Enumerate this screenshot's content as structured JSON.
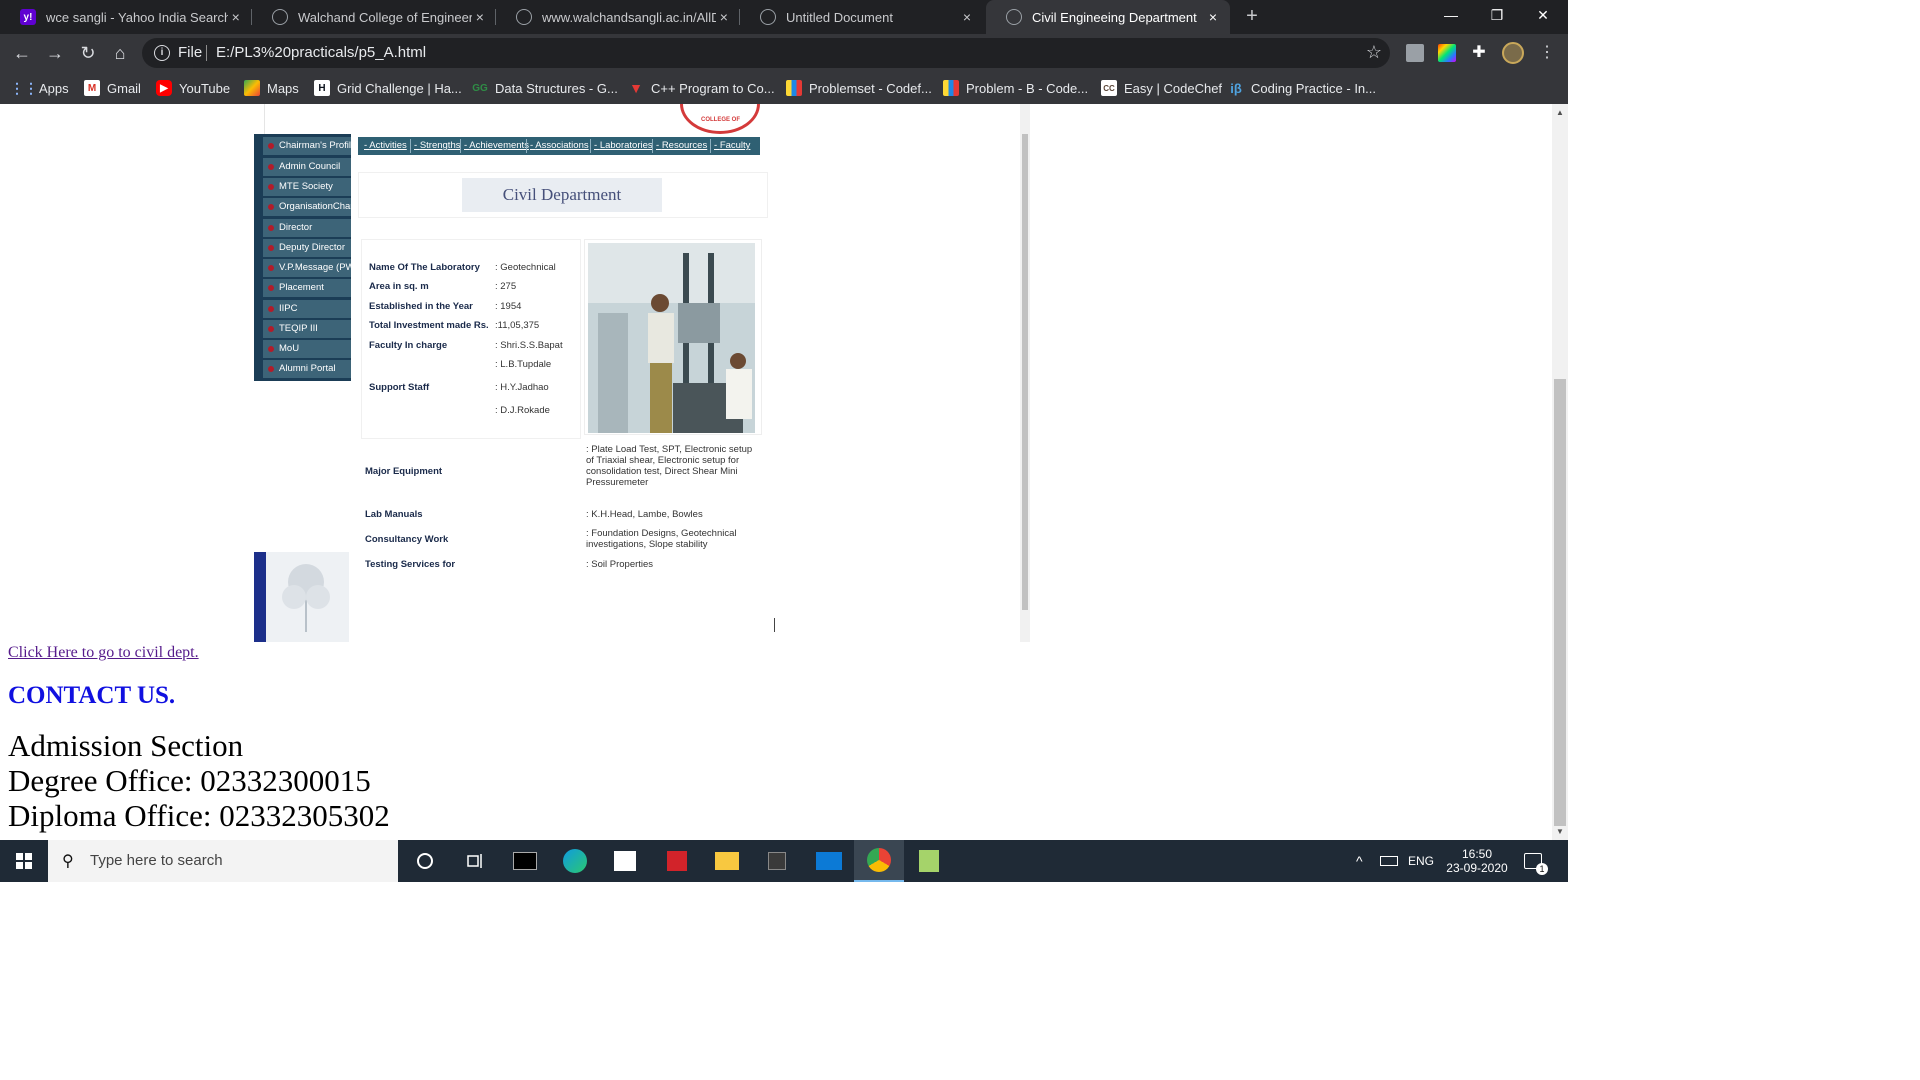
{
  "browser": {
    "tabs": [
      {
        "title": "wce sangli - Yahoo India Search R",
        "favicon": "yahoo-icon",
        "active": false
      },
      {
        "title": "Walchand College of Engineering",
        "favicon": "globe-icon",
        "active": false
      },
      {
        "title": "www.walchandsangli.ac.in/AllDep",
        "favicon": "globe-icon",
        "active": false
      },
      {
        "title": "Untitled Document",
        "favicon": "globe-icon",
        "active": false
      },
      {
        "title": "Civil Engineeing Department",
        "favicon": "globe-icon",
        "active": true
      }
    ],
    "tab_close": "×",
    "new_tab": "+",
    "window_controls": {
      "minimize": "—",
      "maximize": "❐",
      "close": "✕"
    },
    "address": {
      "scheme_label": "File",
      "url": "E:/PL3%20practicals/p5_A.html"
    },
    "bookmarks": [
      {
        "label": "Apps",
        "icon": "apps-grid-icon"
      },
      {
        "label": "Gmail",
        "icon": "gmail-icon"
      },
      {
        "label": "YouTube",
        "icon": "youtube-icon"
      },
      {
        "label": "Maps",
        "icon": "maps-icon"
      },
      {
        "label": "Grid Challenge | Ha...",
        "icon": "hackerrank-icon"
      },
      {
        "label": "Data Structures - G...",
        "icon": "geeksforgeeks-icon"
      },
      {
        "label": "C++ Program to Co...",
        "icon": "tutorialspoint-icon"
      },
      {
        "label": "Problemset - Codef...",
        "icon": "codeforces-icon"
      },
      {
        "label": "Problem - B - Code...",
        "icon": "codeforces-icon"
      },
      {
        "label": "Easy | CodeChef",
        "icon": "codechef-icon"
      },
      {
        "label": "Coding Practice - In...",
        "icon": "interviewbit-icon"
      }
    ]
  },
  "frame": {
    "seal_text": "COLLEGE OF",
    "sidebar": [
      "Chairman's Profile",
      "Admin Council",
      "MTE Society",
      "OrganisationChart",
      "Director",
      "Deputy Director",
      "V.P.Message (PW)",
      "Placement",
      "IIPC",
      "TEQIP III",
      "MoU",
      "Alumni Portal"
    ],
    "top_tabs": [
      "Activities",
      "Strengths",
      "Achievements",
      "Associations",
      "Laboratories",
      "Resources",
      "Faculty"
    ],
    "dept_title": "Civil Department",
    "lab": {
      "name_label": "Name Of The Laboratory",
      "name_value": ": Geotechnical",
      "area_label": "Area in sq. m",
      "area_value": ": 275",
      "year_label": "Established in the Year",
      "year_value": ": 1954",
      "investment_label": "Total Investment made Rs.",
      "investment_value": ":11,05,375",
      "faculty_label": "Faculty In charge",
      "faculty_value_1": ": Shri.S.S.Bapat",
      "faculty_value_2": ": L.B.Tupdale",
      "staff_label": "Support Staff",
      "staff_value_1": ": H.Y.Jadhao",
      "staff_value_2": ": D.J.Rokade",
      "equipment_label": "Major Equipment",
      "equipment_value": ": Plate Load Test, SPT, Electronic setup of Triaxial shear, Electronic setup for consolidation test, Direct Shear Mini Pressuremeter",
      "manuals_label": "Lab Manuals",
      "manuals_value": ": K.H.Head, Lambe, Bowles",
      "consultancy_label": "Consultancy Work",
      "consultancy_value": ": Foundation Designs, Geotechnical investigations, Slope stability",
      "testing_label": "Testing Services for",
      "testing_value": ": Soil Properties"
    }
  },
  "page": {
    "link_text": "Click Here to go to civil dept.",
    "contact_heading": "CONTACT US.",
    "address_lines": [
      "Admission Section",
      "Degree Office: 02332300015",
      "Diploma Office: 02332305302"
    ]
  },
  "taskbar": {
    "search_placeholder": "Type here to search",
    "language": "ENG",
    "time": "16:50",
    "date": "23-09-2020",
    "notification_count": "1"
  }
}
